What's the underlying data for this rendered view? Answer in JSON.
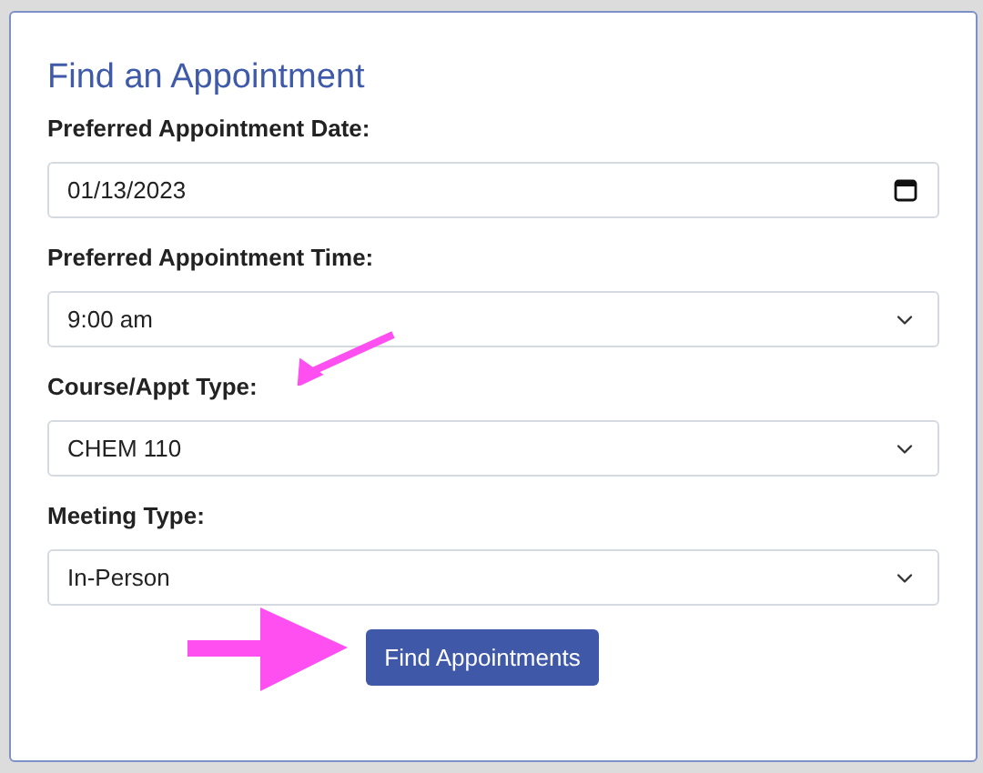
{
  "title": "Find an Appointment",
  "fields": [
    {
      "kind": "date",
      "label": "Preferred Appointment Date:",
      "value": "01/13/2023"
    },
    {
      "kind": "select",
      "label": "Preferred Appointment Time:",
      "value": "9:00 am"
    },
    {
      "kind": "select",
      "label": "Course/Appt Type:",
      "value": "CHEM 110"
    },
    {
      "kind": "select",
      "label": "Meeting Type:",
      "value": "In-Person"
    }
  ],
  "button": "Find Appointments"
}
